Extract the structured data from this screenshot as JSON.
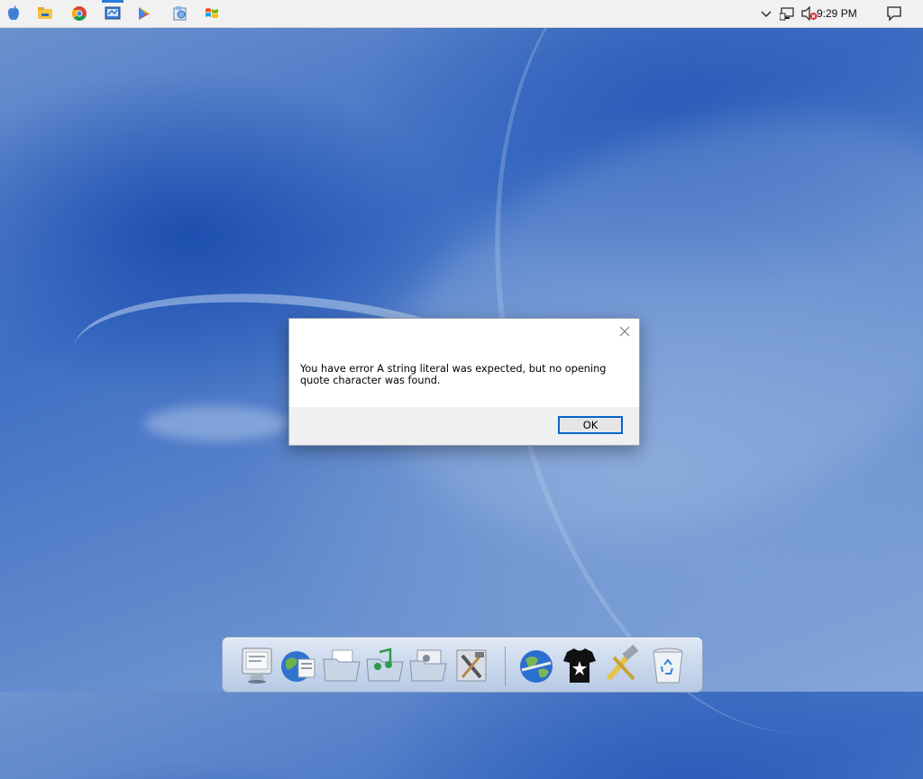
{
  "taskbar": {
    "apps": [
      {
        "icon": "apple-icon"
      },
      {
        "icon": "file-explorer-icon"
      },
      {
        "icon": "chrome-icon"
      },
      {
        "icon": "control-panel-icon",
        "active": true
      },
      {
        "icon": "play-store-icon"
      },
      {
        "icon": "installer-icon"
      },
      {
        "icon": "windows-flag-icon"
      }
    ],
    "tray": {
      "icons": [
        "chevron-up-icon",
        "network-icon",
        "volume-muted-icon",
        "action-center-icon"
      ],
      "clock": "9:29 PM"
    }
  },
  "dialog": {
    "message": "You have error A string literal was expected, but no opening quote character was found.",
    "ok_label": "OK"
  },
  "dock": {
    "items": [
      {
        "icon": "finder-monitor-icon"
      },
      {
        "icon": "internet-globe-icon"
      },
      {
        "icon": "documents-folder-icon"
      },
      {
        "icon": "music-folder-icon"
      },
      {
        "icon": "pictures-folder-icon"
      },
      {
        "icon": "system-preferences-icon"
      },
      {
        "icon": "network-globe-icon"
      },
      {
        "icon": "tshirt-icon"
      },
      {
        "icon": "tools-hammer-icon"
      },
      {
        "icon": "recycle-bin-icon"
      }
    ]
  },
  "colors": {
    "accent": "#0a64c8",
    "taskbar": "#f1f1f1",
    "desktop": "#4a78c6"
  }
}
